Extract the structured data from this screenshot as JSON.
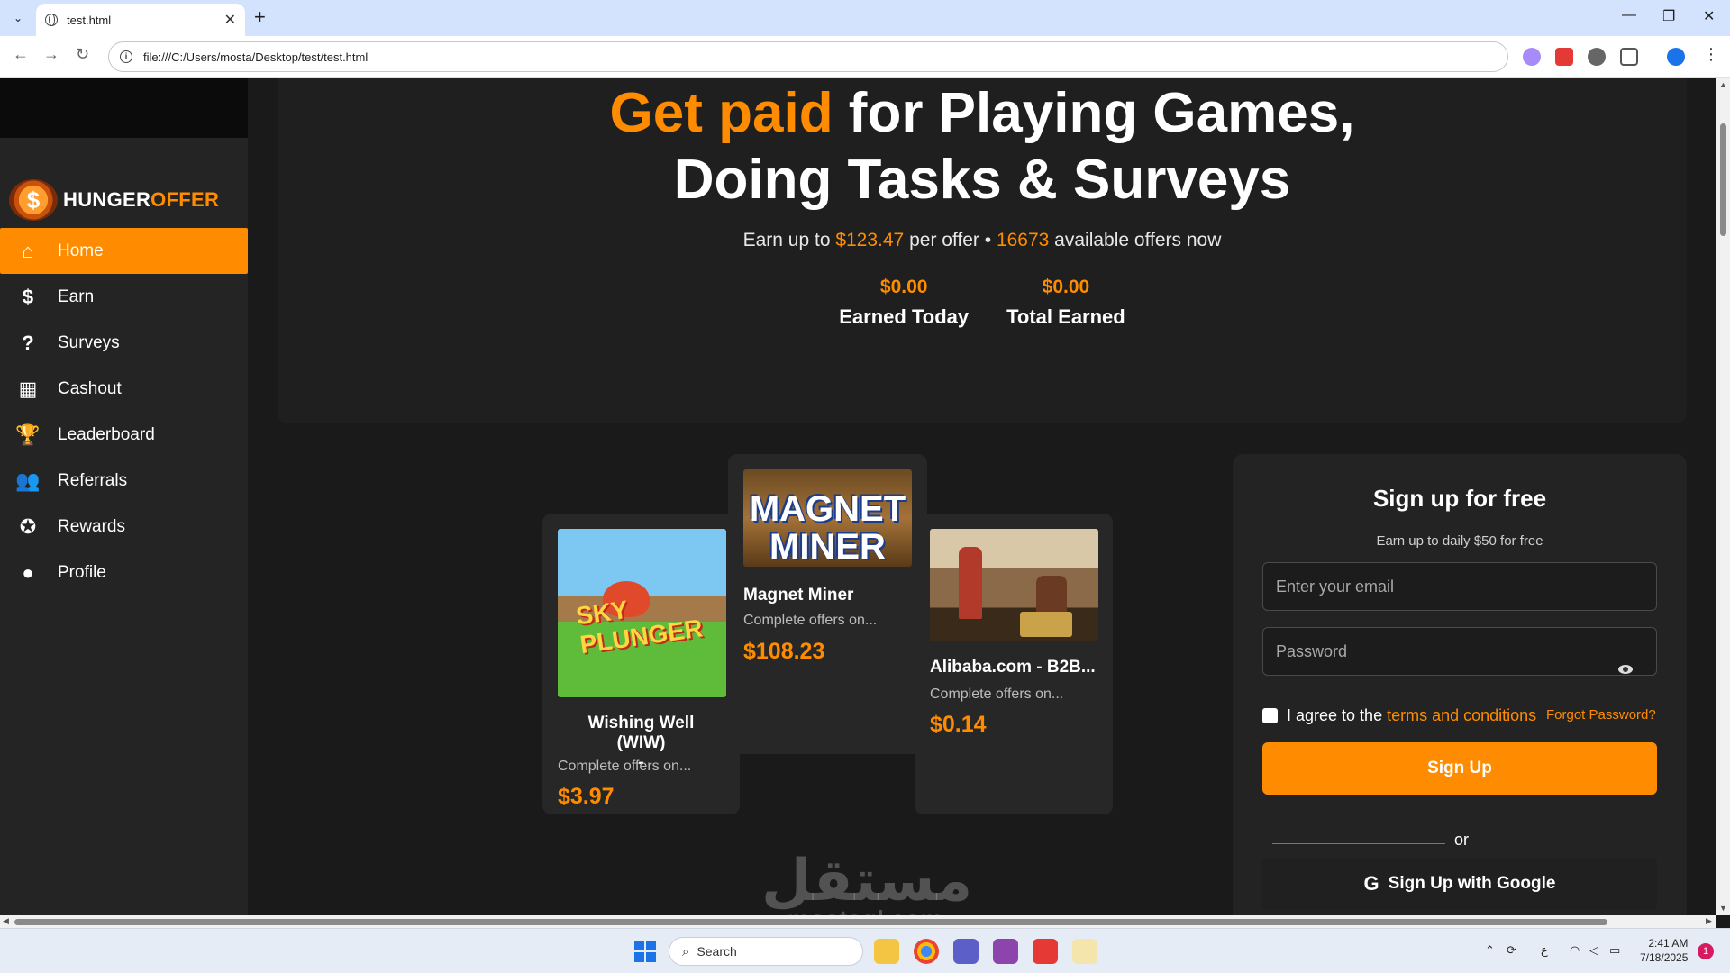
{
  "browser": {
    "tab_title": "test.html",
    "url": "file:///C:/Users/mosta/Desktop/test/test.html"
  },
  "site": {
    "logo_part1": "HUNGER",
    "logo_part2": "OFFER",
    "coin_symbol": "$"
  },
  "sidebar": {
    "items": [
      {
        "label": "Home",
        "icon": "home-icon",
        "glyph": "⌂"
      },
      {
        "label": "Earn",
        "icon": "dollar-icon",
        "glyph": "$"
      },
      {
        "label": "Surveys",
        "icon": "clipboard-question-icon",
        "glyph": "?"
      },
      {
        "label": "Cashout",
        "icon": "cash-register-icon",
        "glyph": "▦"
      },
      {
        "label": "Leaderboard",
        "icon": "trophy-icon",
        "glyph": "🏆"
      },
      {
        "label": "Referrals",
        "icon": "users-icon",
        "glyph": "👥"
      },
      {
        "label": "Rewards",
        "icon": "award-icon",
        "glyph": "✪"
      },
      {
        "label": "Profile",
        "icon": "user-circle-icon",
        "glyph": "●"
      }
    ]
  },
  "hero": {
    "title_accent": "Get paid",
    "title_rest": " for Playing Games,",
    "title_line2": "Doing Tasks & Surveys",
    "sub_pre": "Earn up to ",
    "sub_amount": "$123.47",
    "sub_mid": " per offer • ",
    "sub_count": "16673",
    "sub_post": " available offers now",
    "stats": [
      {
        "value": "$0.00",
        "label": "Earned Today"
      },
      {
        "value": "$0.00",
        "label": "Total Earned"
      }
    ]
  },
  "offers": [
    {
      "name": "Wishing Well (WIW)",
      "name_line2": "-",
      "desc": "Complete offers on...",
      "price": "$3.97",
      "image_text": "SKY PLUNGER"
    },
    {
      "name": "Magnet Miner",
      "desc": "Complete offers on...",
      "price": "$108.23",
      "image_text1": "MAGNET",
      "image_text2": "MINER"
    },
    {
      "name": "Alibaba.com - B2B...",
      "desc": "Complete offers on...",
      "price": "$0.14"
    }
  ],
  "signup": {
    "title": "Sign up for free",
    "subtitle": "Earn up to daily $50 for free",
    "email_placeholder": "Enter your email",
    "password_placeholder": "Password",
    "agree_text": "I agree to the",
    "terms_link": "terms and conditions",
    "forgot": "Forgot Password?",
    "button": "Sign Up",
    "or": "or",
    "google_letter": "G",
    "google_button": "Sign Up with Google"
  },
  "watermark": {
    "arabic": "مستقل",
    "latin": "mostaql.com"
  },
  "taskbar": {
    "search": "Search",
    "lang": "ع",
    "time": "2:41 AM",
    "date": "7/18/2025",
    "notifications": "1"
  },
  "colors": {
    "accent": "#ff8c00",
    "sidebar_bg": "#242424",
    "page_bg": "#1a1a1a"
  }
}
